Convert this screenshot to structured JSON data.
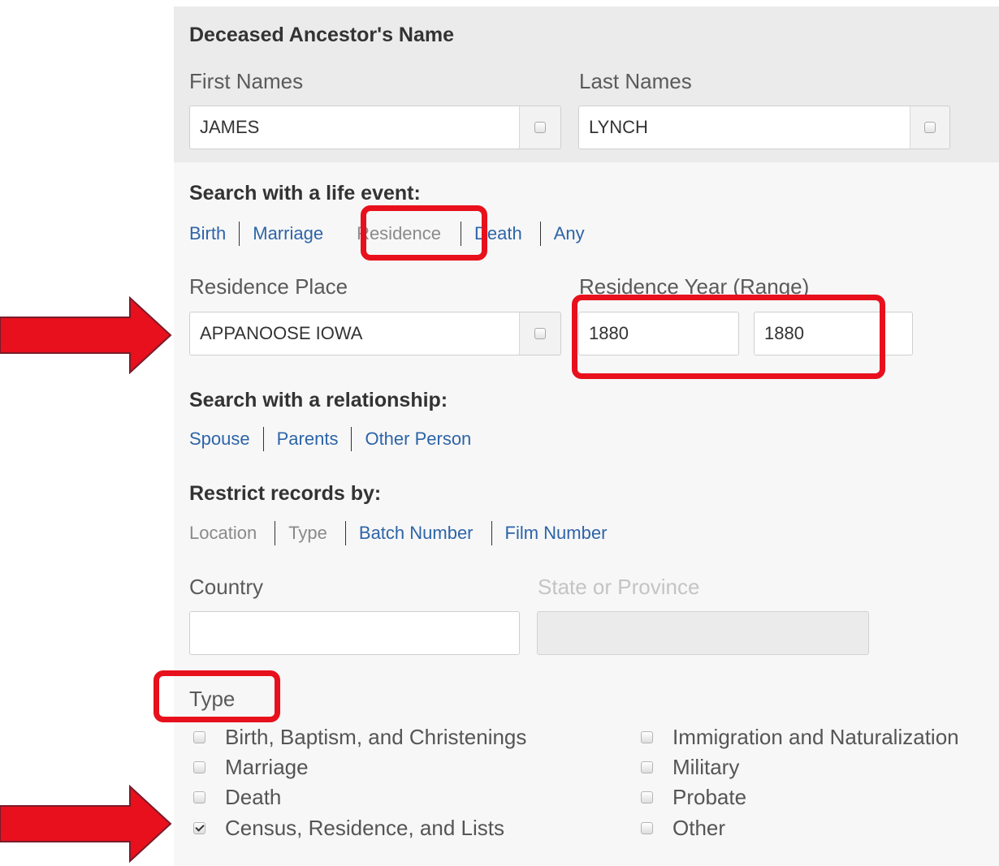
{
  "name_section": {
    "heading": "Deceased Ancestor's Name",
    "first_names_label": "First Names",
    "first_names_value": "JAMES",
    "last_names_label": "Last Names",
    "last_names_value": "LYNCH"
  },
  "life_event": {
    "heading": "Search with a life event:",
    "tabs": [
      {
        "label": "Birth",
        "active": false
      },
      {
        "label": "Marriage",
        "active": false
      },
      {
        "label": "Residence",
        "active": true
      },
      {
        "label": "Death",
        "active": false
      },
      {
        "label": "Any",
        "active": false
      }
    ],
    "place_label": "Residence Place",
    "place_value": "APPANOOSE IOWA",
    "year_label": "Residence Year (Range)",
    "year_from": "1880",
    "year_to": "1880"
  },
  "relationship": {
    "heading": "Search with a relationship:",
    "links": [
      "Spouse",
      "Parents",
      "Other Person"
    ]
  },
  "restrict": {
    "heading": "Restrict records by:",
    "links": [
      {
        "label": "Location",
        "active": false
      },
      {
        "label": "Type",
        "active": false
      },
      {
        "label": "Batch Number",
        "active": true
      },
      {
        "label": "Film Number",
        "active": true
      }
    ],
    "country_label": "Country",
    "country_value": "",
    "state_label": "State or Province",
    "state_value": ""
  },
  "type_section": {
    "label": "Type",
    "options_left": [
      {
        "label": "Birth, Baptism, and Christenings",
        "checked": false
      },
      {
        "label": "Marriage",
        "checked": false
      },
      {
        "label": "Death",
        "checked": false
      },
      {
        "label": "Census, Residence, and Lists",
        "checked": true
      }
    ],
    "options_right": [
      {
        "label": "Immigration and Naturalization",
        "checked": false
      },
      {
        "label": "Military",
        "checked": false
      },
      {
        "label": "Probate",
        "checked": false
      },
      {
        "label": "Other",
        "checked": false
      }
    ]
  },
  "annotation_color": "#e8101c"
}
